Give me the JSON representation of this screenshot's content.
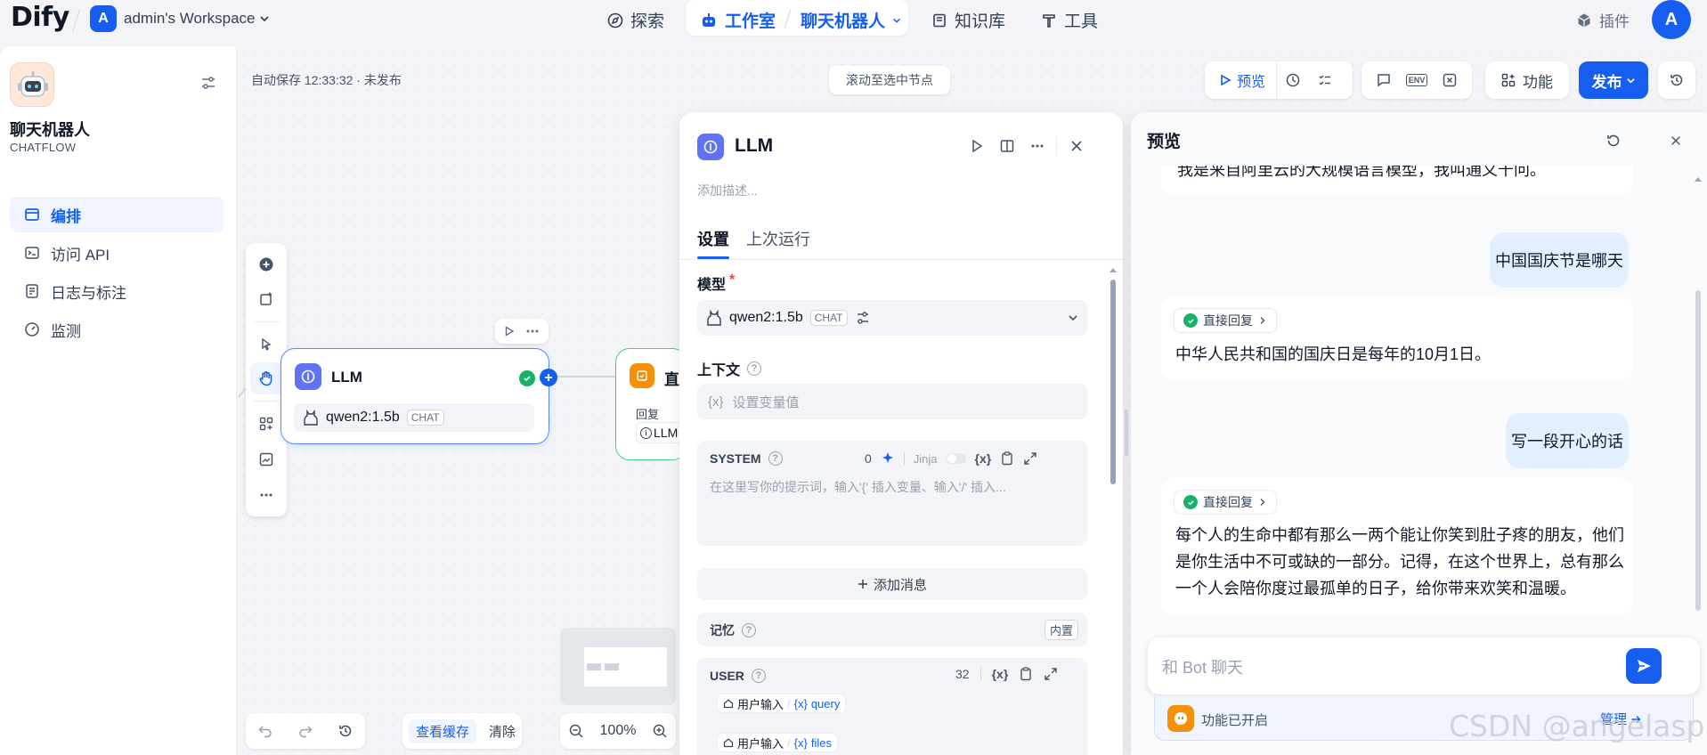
{
  "brand": {
    "logo": "Dify"
  },
  "workspace": {
    "avatar_letter": "A",
    "name": "admin's Workspace"
  },
  "topnav": {
    "explore": "探索",
    "studio": "工作室",
    "app": "聊天机器人",
    "knowledge": "知识库",
    "tools": "工具",
    "plugins": "插件",
    "user_letter": "A"
  },
  "sidebar": {
    "app_name": "聊天机器人",
    "app_type": "CHATFLOW",
    "items": [
      {
        "label": "编排",
        "icon": "layout-icon",
        "active": true
      },
      {
        "label": "访问 API",
        "icon": "terminal-icon"
      },
      {
        "label": "日志与标注",
        "icon": "file-icon"
      },
      {
        "label": "监测",
        "icon": "gauge-icon"
      }
    ]
  },
  "canvas": {
    "autosave": "自动保存 12:33:32 · 未发布",
    "scroll_to_node": "滚动至选中节点",
    "view_cache": "查看缓存",
    "clear": "清除",
    "zoom": "100%"
  },
  "toolbar": {
    "preview": "预览",
    "features": "功能",
    "publish": "发布"
  },
  "node_llm": {
    "title": "LLM",
    "model": "qwen2:1.5b",
    "mode": "CHAT"
  },
  "node_answer": {
    "title": "直",
    "reply_label": "回复",
    "ref": "LLM"
  },
  "llm_panel": {
    "title": "LLM",
    "desc_placeholder": "添加描述...",
    "tab_settings": "设置",
    "tab_last_run": "上次运行",
    "model_label": "模型",
    "required": "*",
    "model_name": "qwen2:1.5b",
    "model_mode": "CHAT",
    "context_label": "上下文",
    "context_placeholder": "设置变量值",
    "var_token": "{x}",
    "system_label": "SYSTEM",
    "system_count": "0",
    "jinja": "Jinja",
    "system_placeholder": "在这里写你的提示词，输入'{' 插入变量、输入'/' 插入...",
    "add_message": "添加消息",
    "memory_label": "记忆",
    "builtin": "内置",
    "user_label": "USER",
    "user_count": "32",
    "user_input_label": "用户输入",
    "query_var": "query",
    "files_var": "files"
  },
  "preview": {
    "title": "预览",
    "top_partial": "我是来自阿里云的大规模语言模型，我叫通义千问。",
    "messages": [
      {
        "role": "user",
        "text": "中国国庆节是哪天"
      },
      {
        "role": "bot",
        "tag": "直接回复",
        "lines": [
          "中华人民共和国的国庆日是每年的10月1日。"
        ]
      },
      {
        "role": "user",
        "text": "写一段开心的话"
      },
      {
        "role": "bot",
        "tag": "直接回复",
        "lines": [
          "每个人的生命中都有那么一两个能让你笑到肚子疼的朋友，他们",
          "是你生活中不可或缺的一部分。记得，在这个世界上，总有那么",
          "一个人会陪你度过最孤单的日子，给你带来欢笑和温暖。"
        ]
      }
    ],
    "input_placeholder": "和 Bot 聊天",
    "features_enabled": "功能已开启",
    "manage": "管理"
  },
  "watermark": "CSDN @angelasp",
  "colors": {
    "accent": "#155eef",
    "success": "#17b26a",
    "llm_node": "#6172f3",
    "answer_node": "#f79009"
  }
}
